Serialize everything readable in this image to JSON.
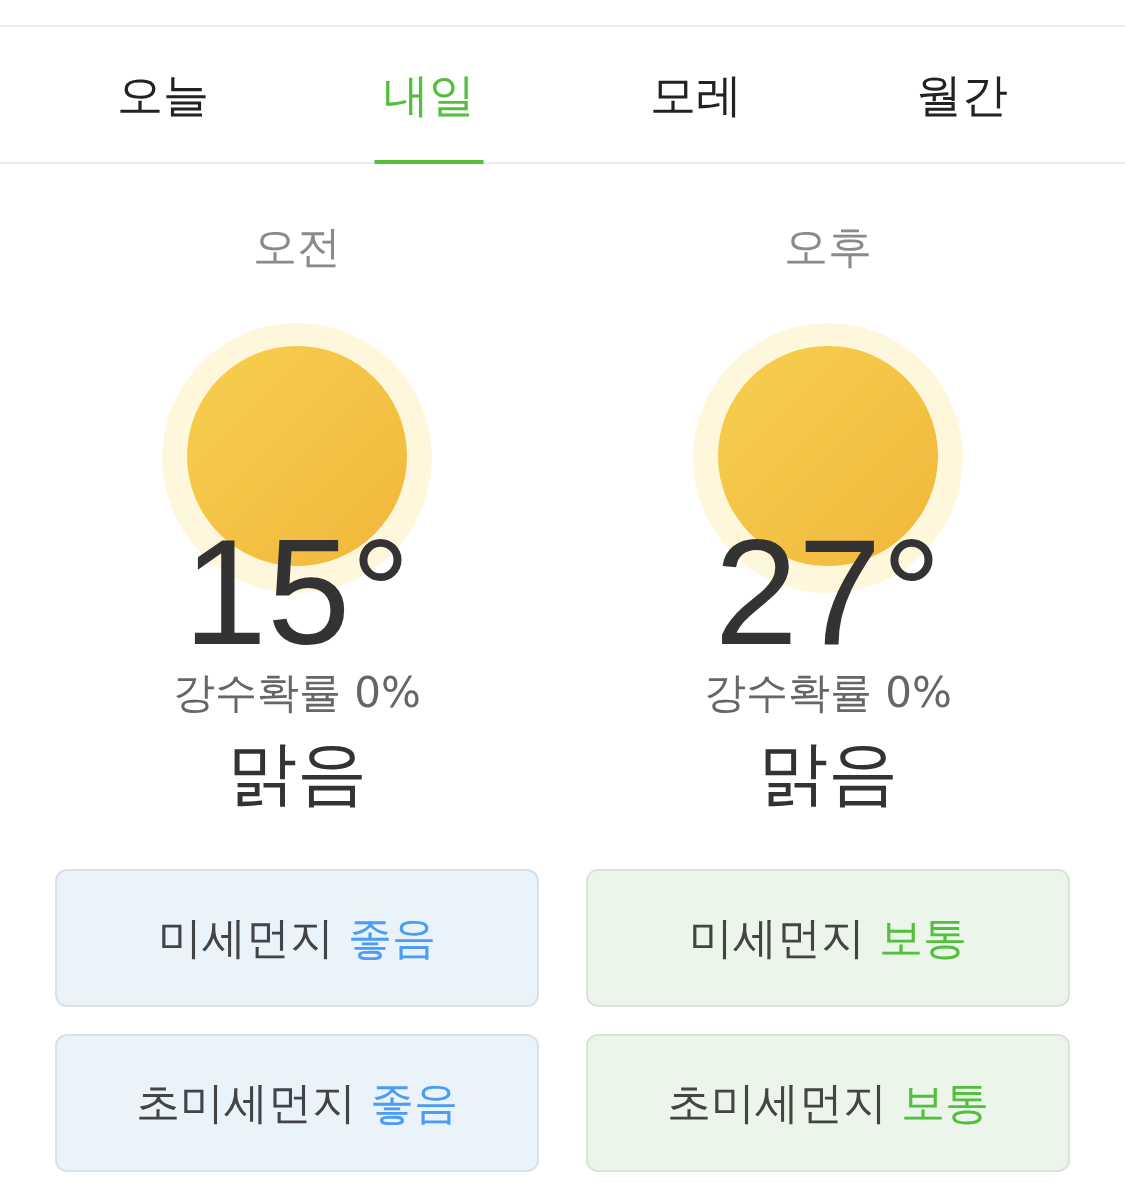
{
  "tabs": [
    {
      "label": "오늘",
      "selected": false
    },
    {
      "label": "내일",
      "selected": true
    },
    {
      "label": "모레",
      "selected": false
    },
    {
      "label": "월간",
      "selected": false
    }
  ],
  "periods": [
    {
      "label": "오전",
      "temperature": "15°",
      "precipitation": "강수확률 0%",
      "condition": "맑음",
      "air_quality": [
        {
          "label": "미세먼지",
          "grade": "좋음",
          "color": "#4a9cf5"
        },
        {
          "label": "초미세먼지",
          "grade": "좋음",
          "color": "#4a9cf5"
        }
      ]
    },
    {
      "label": "오후",
      "temperature": "27°",
      "precipitation": "강수확률 0%",
      "condition": "맑음",
      "air_quality": [
        {
          "label": "미세먼지",
          "grade": "보통",
          "color": "#52c03d"
        },
        {
          "label": "초미세먼지",
          "grade": "보통",
          "color": "#52c03d"
        }
      ]
    }
  ]
}
